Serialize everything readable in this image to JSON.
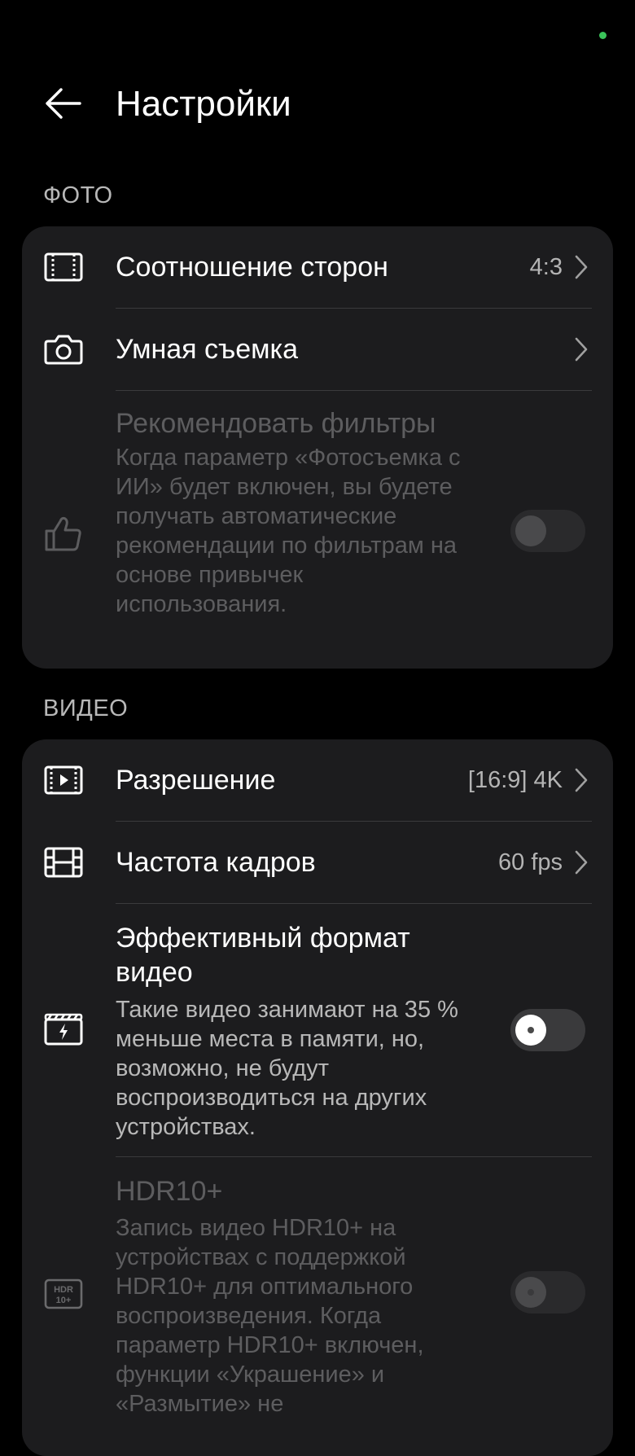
{
  "colors": {
    "background": "#000000",
    "card": "#1c1c1e",
    "status_dot": "#3ac35a"
  },
  "header": {
    "back_icon": "back-arrow-icon",
    "title": "Настройки"
  },
  "photo": {
    "section_title": "ФОТО",
    "aspect_ratio": {
      "icon": "aspect-ratio-icon",
      "label": "Соотношение сторон",
      "value": "4:3"
    },
    "smart_shooting": {
      "icon": "camera-icon",
      "label": "Умная съемка"
    },
    "recommend_filters": {
      "icon": "thumbs-up-icon",
      "label": "Рекомендовать фильтры",
      "description": "Когда параметр «Фотосъемка с ИИ» будет включен, вы будете получать автоматические рекомендации по фильтрам на основе привычек использования.",
      "enabled": false,
      "on": false
    }
  },
  "video": {
    "section_title": "ВИДЕО",
    "resolution": {
      "icon": "video-resolution-icon",
      "label": "Разрешение",
      "value": "[16:9] 4K"
    },
    "frame_rate": {
      "icon": "film-icon",
      "label": "Частота кадров",
      "value": "60 fps"
    },
    "efficient_format": {
      "icon": "efficient-video-icon",
      "label": "Эффективный формат видео",
      "description": "Такие видео занимают на 35 % меньше места в памяти, но, возможно, не будут воспроизводиться на других устройствах.",
      "on": false
    },
    "hdr10": {
      "icon": "hdr10-plus-icon",
      "icon_text_top": "HDR",
      "icon_text_bottom": "10+",
      "label": "HDR10+",
      "description": "Запись видео HDR10+ на устройствах с поддержкой HDR10+ для оптимального воспроизведения. Когда параметр HDR10+ включен, функции «Украшение» и «Размытие» не",
      "enabled": false,
      "on": false
    }
  }
}
